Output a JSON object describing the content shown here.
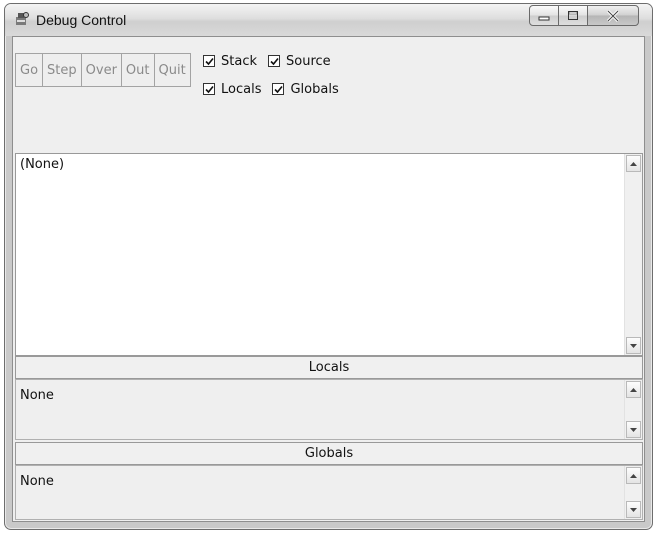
{
  "window": {
    "title": "Debug Control",
    "controls": [
      "minimize",
      "maximize",
      "close"
    ]
  },
  "toolbar": {
    "buttons": [
      "Go",
      "Step",
      "Over",
      "Out",
      "Quit"
    ],
    "checkboxes": [
      {
        "label": "Stack",
        "checked": true
      },
      {
        "label": "Source",
        "checked": true
      },
      {
        "label": "Locals",
        "checked": true
      },
      {
        "label": "Globals",
        "checked": true
      }
    ]
  },
  "stack_panel": {
    "text": "(None)"
  },
  "locals_panel": {
    "header": "Locals",
    "text": "None"
  },
  "globals_panel": {
    "header": "Globals",
    "text": "None"
  },
  "colors": {
    "disabled_button_text": "#8a8a8a",
    "panel_background": "#efefef"
  },
  "icons": [
    "debug-app-icon",
    "minimize-icon",
    "maximize-icon",
    "close-icon",
    "checkmark-icon",
    "scroll-up-icon",
    "scroll-down-icon"
  ]
}
